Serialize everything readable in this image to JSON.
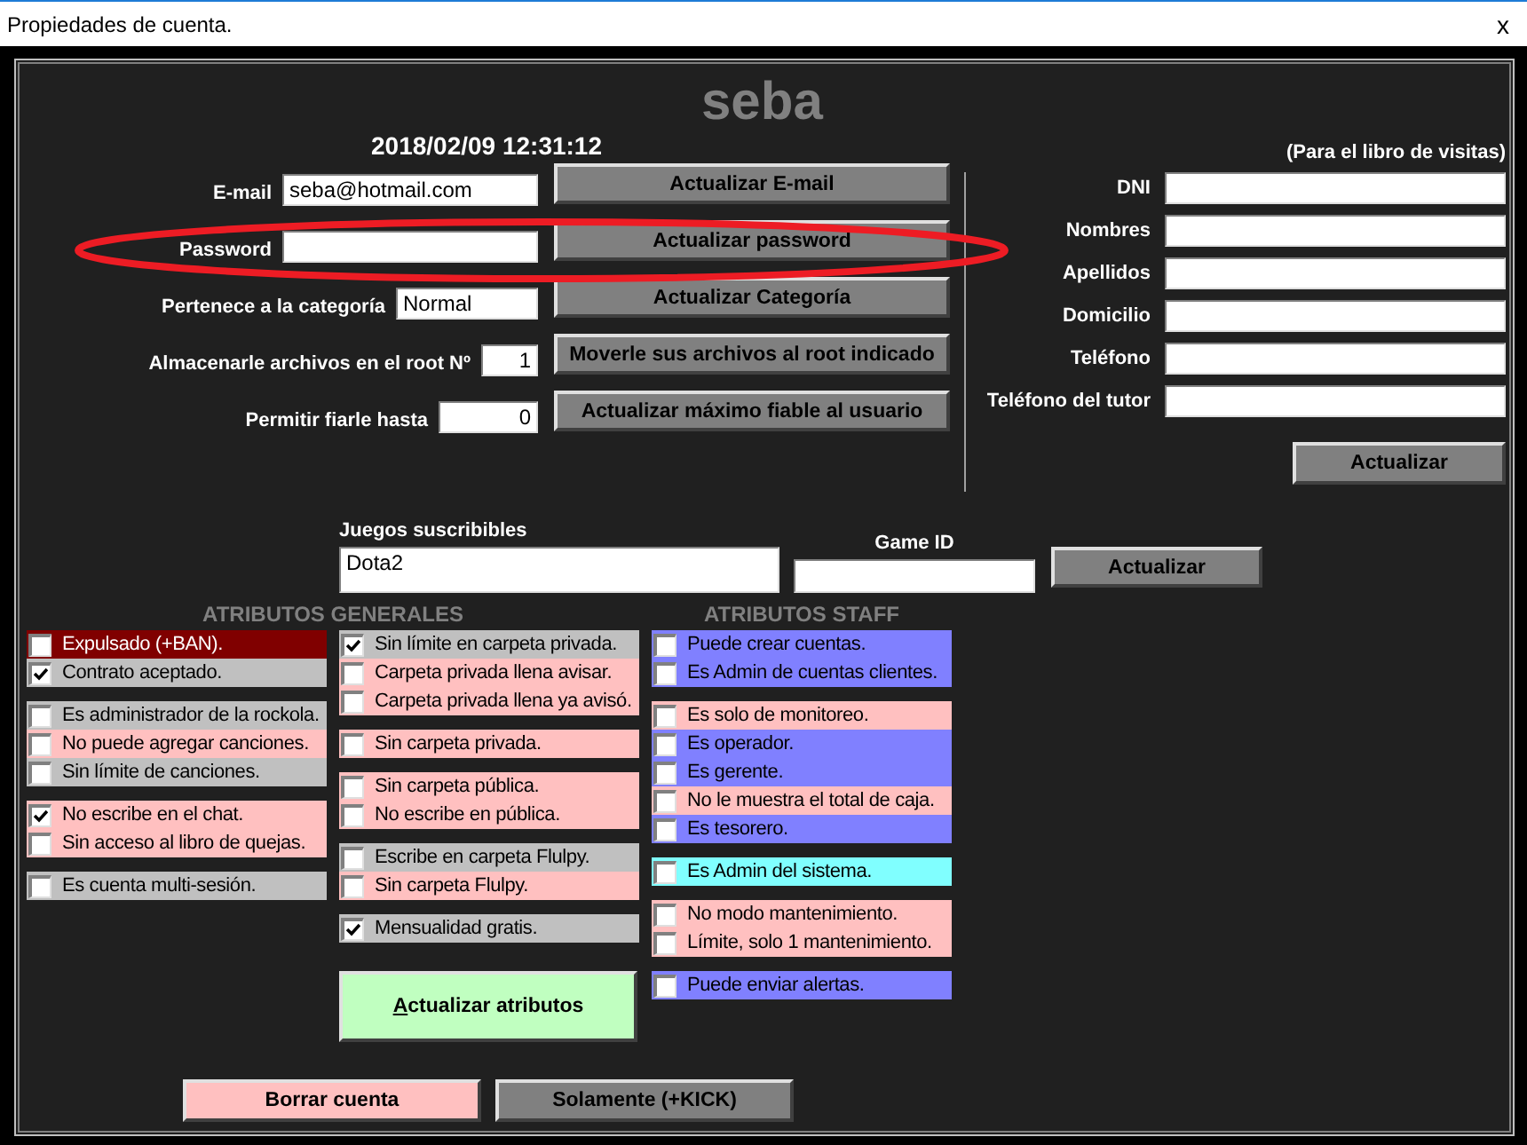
{
  "window": {
    "title": "Propiedades de cuenta.",
    "close": "x"
  },
  "user": {
    "name": "seba",
    "timestamp": "2018/02/09 12:31:12"
  },
  "account_rows": [
    {
      "label": "E-mail",
      "value": "seba@hotmail.com",
      "kind": "text",
      "button": "Actualizar E-mail",
      "highlighted": false
    },
    {
      "label": "Password",
      "kind": "text",
      "button": "Actualizar password",
      "highlighted": true
    },
    {
      "label": "Pertenece a la categoría",
      "value": "Normal",
      "kind": "text",
      "button": "Actualizar Categoría",
      "highlighted": false
    },
    {
      "label": "Almacenarle archivos en el root Nº",
      "value": "1",
      "kind": "number",
      "button": "Moverle sus archivos al root indicado",
      "highlighted": false
    },
    {
      "label": "Permitir fiarle hasta",
      "value": "0",
      "kind": "number",
      "button": "Actualizar máximo fiable al usuario",
      "highlighted": false
    }
  ],
  "guestbook": {
    "note": "(Para el libro de visitas)",
    "fields": [
      {
        "label": "DNI"
      },
      {
        "label": "Nombres"
      },
      {
        "label": "Apellidos"
      },
      {
        "label": "Domicilio"
      },
      {
        "label": "Teléfono"
      },
      {
        "label": "Teléfono del tutor"
      }
    ],
    "button": "Actualizar"
  },
  "games": {
    "label": "Juegos suscribibles",
    "value": "Dota2",
    "game_id_label": "Game ID",
    "button": "Actualizar"
  },
  "general_attributes": {
    "title": "ATRIBUTOS GENERALES",
    "columns": [
      {
        "groups": [
          [
            {
              "label": "Expulsado (+BAN).",
              "checked": false,
              "color": "#800000"
            },
            {
              "label": "Contrato aceptado.",
              "checked": true,
              "color": "#c0c0c0"
            }
          ],
          [
            {
              "label": "Es administrador de la rockola.",
              "checked": false,
              "color": "#c0c0c0"
            },
            {
              "label": "No puede agregar canciones.",
              "checked": false,
              "color": "#ffc0c0"
            },
            {
              "label": "Sin límite de canciones.",
              "checked": false,
              "color": "#c0c0c0"
            }
          ],
          [
            {
              "label": "No escribe en el chat.",
              "checked": true,
              "color": "#ffc0c0"
            },
            {
              "label": "Sin acceso al libro de quejas.",
              "checked": false,
              "color": "#ffc0c0"
            }
          ],
          [
            {
              "label": "Es cuenta multi-sesión.",
              "checked": false,
              "color": "#c0c0c0"
            }
          ]
        ]
      },
      {
        "groups": [
          [
            {
              "label": "Sin límite en carpeta privada.",
              "checked": true,
              "color": "#c0c0c0"
            },
            {
              "label": "Carpeta privada llena avisar.",
              "checked": false,
              "color": "#ffc0c0"
            },
            {
              "label": "Carpeta privada llena ya avisó.",
              "checked": false,
              "color": "#ffc0c0"
            }
          ],
          [
            {
              "label": "Sin carpeta privada.",
              "checked": false,
              "color": "#ffc0c0"
            }
          ],
          [
            {
              "label": "Sin carpeta pública.",
              "checked": false,
              "color": "#ffc0c0"
            },
            {
              "label": "No escribe en pública.",
              "checked": false,
              "color": "#ffc0c0"
            }
          ],
          [
            {
              "label": "Escribe en carpeta Flulpy.",
              "checked": false,
              "color": "#c0c0c0"
            },
            {
              "label": "Sin carpeta Flulpy.",
              "checked": false,
              "color": "#ffc0c0"
            }
          ],
          [
            {
              "label": "Mensualidad gratis.",
              "checked": true,
              "color": "#c0c0c0"
            }
          ]
        ]
      }
    ],
    "button": "Actualizar atributos"
  },
  "staff_attributes": {
    "title": "ATRIBUTOS STAFF",
    "groups": [
      [
        {
          "label": "Puede crear cuentas.",
          "checked": false,
          "color": "#8080ff"
        },
        {
          "label": "Es Admin de cuentas clientes.",
          "checked": false,
          "color": "#8080ff"
        }
      ],
      [
        {
          "label": "Es solo de monitoreo.",
          "checked": false,
          "color": "#ffc0c0"
        },
        {
          "label": "Es operador.",
          "checked": false,
          "color": "#8080ff"
        },
        {
          "label": "Es gerente.",
          "checked": false,
          "color": "#8080ff"
        },
        {
          "label": "No le muestra el total de caja.",
          "checked": false,
          "color": "#ffc0c0"
        },
        {
          "label": "Es tesorero.",
          "checked": false,
          "color": "#8080ff"
        }
      ],
      [
        {
          "label": "Es Admin del sistema.",
          "checked": false,
          "color": "#80ffff"
        }
      ],
      [
        {
          "label": "No modo mantenimiento.",
          "checked": false,
          "color": "#ffc0c0"
        },
        {
          "label": "Límite, solo 1 mantenimiento.",
          "checked": false,
          "color": "#ffc0c0"
        }
      ],
      [
        {
          "label": "Puede enviar alertas.",
          "checked": false,
          "color": "#8080ff"
        }
      ]
    ]
  },
  "actions": [
    {
      "label": "Borrar cuenta",
      "color": "#ffc0c0"
    },
    {
      "label": "Solamente (+KICK)",
      "color": "#808080"
    }
  ]
}
